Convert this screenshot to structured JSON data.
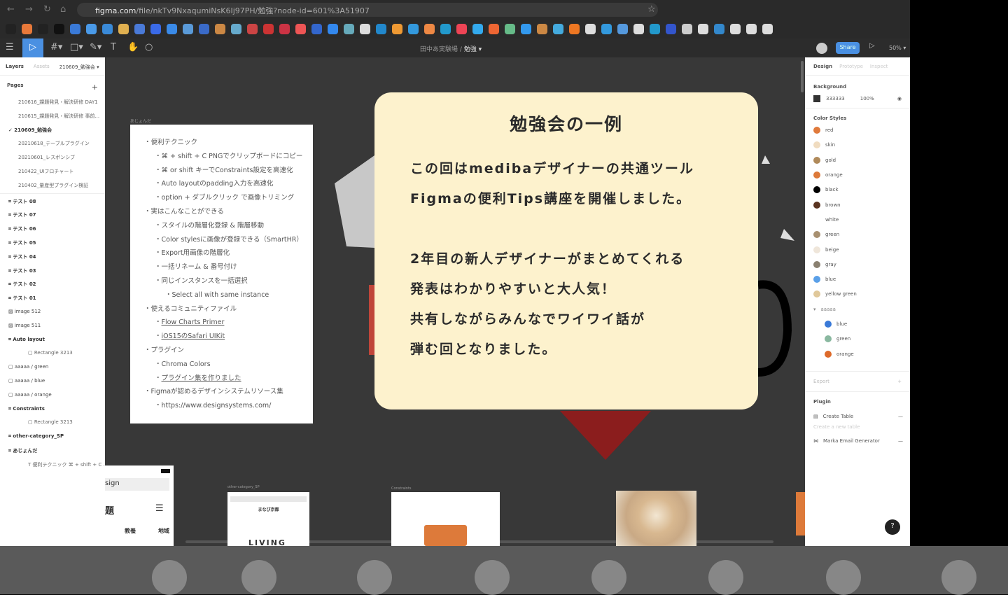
{
  "browser": {
    "url_domain": "figma.com",
    "url_path": "/file/nkTv9NxaqumiNsK6Ij97PH/勉強?node-id=601%3A51907"
  },
  "toolbar": {
    "breadcrumb_team": "田中あ実験場",
    "breadcrumb_sep": "/",
    "breadcrumb_file": "勉強 ▾",
    "share": "Share",
    "zoom": "50% ▾"
  },
  "left": {
    "tab_layers": "Layers",
    "tab_assets": "Assets",
    "page_select": "210609_勉強会 ▾",
    "pages_label": "Pages",
    "add": "+",
    "pages": [
      "210616_課題発見・解決研修 DAY1",
      "210615_課題発見・解決研修 事前...",
      "✓ 210609_勉強会",
      "20210618_テーブルプラグイン",
      "20210601_レスポンシブ",
      "210422_UIフロチャート",
      "210402_量産型プラグイン検証"
    ],
    "layers": [
      {
        "t": "⌗ テスト 08",
        "c": "bold"
      },
      {
        "t": "⌗ テスト 07",
        "c": "bold"
      },
      {
        "t": "⌗ テスト 06",
        "c": "bold"
      },
      {
        "t": "⌗ テスト 05",
        "c": "bold"
      },
      {
        "t": "⌗ テスト 04",
        "c": "bold"
      },
      {
        "t": "⌗ テスト 03",
        "c": "bold"
      },
      {
        "t": "⌗ テスト 02",
        "c": "bold"
      },
      {
        "t": "⌗ テスト 01",
        "c": "bold"
      },
      {
        "t": "▨ image 512",
        "c": ""
      },
      {
        "t": "▨ image 511",
        "c": ""
      },
      {
        "t": "⌗ Auto layout",
        "c": "bold"
      },
      {
        "t": "▢ Rectangle 3213",
        "c": "ind"
      },
      {
        "t": "▢ aaaaa / green",
        "c": ""
      },
      {
        "t": "▢ aaaaa / blue",
        "c": ""
      },
      {
        "t": "▢ aaaaa / orange",
        "c": ""
      },
      {
        "t": "⌗ Constraints",
        "c": "bold"
      },
      {
        "t": "▢ Rectangle 3213",
        "c": "ind"
      },
      {
        "t": "⌗ other-category_SP",
        "c": "bold"
      },
      {
        "t": "⌗ あじょんだ",
        "c": "bold"
      },
      {
        "t": "T 便利テクニック ⌘ + shift + C ...",
        "c": "ind"
      }
    ]
  },
  "canvas": {
    "note_label": "あじょんだ",
    "note": [
      {
        "t": "便利テクニック",
        "l": 1
      },
      {
        "t": "⌘ + shift + C PNGでクリップボードにコピー",
        "l": 2
      },
      {
        "t": "⌘ or shift キーでConstraints設定を高速化",
        "l": 2
      },
      {
        "t": "Auto layoutのpadding入力を高速化",
        "l": 2
      },
      {
        "t": "option + ダブルクリック で画像トリミング",
        "l": 2
      },
      {
        "t": "実はこんなことができる",
        "l": 1
      },
      {
        "t": "スタイルの階層化登録 & 階層移動",
        "l": 2
      },
      {
        "t": "Color stylesに画像が登録できる（SmartHR）",
        "l": 2
      },
      {
        "t": "Export用画像の階層化",
        "l": 2
      },
      {
        "t": "一括リネーム & 番号付け",
        "l": 2
      },
      {
        "t": "同じインスタンスを一括選択",
        "l": 2
      },
      {
        "t": "Select all with same instance",
        "l": 3
      },
      {
        "t": "使えるコミュニティファイル",
        "l": 1
      },
      {
        "t": "Flow Charts Primer",
        "l": 2,
        "link": true
      },
      {
        "t": "iOS15のSafari UIKit",
        "l": 2,
        "link": true
      },
      {
        "t": "プラグイン",
        "l": 1
      },
      {
        "t": "Chroma Colors",
        "l": 2
      },
      {
        "t": "プラグイン集を作りました",
        "l": 2,
        "link": true
      },
      {
        "t": "Figmaが認めるデザインシステムリソース集",
        "l": 1
      },
      {
        "t": "https://www.designsystems.com/",
        "l": 2
      }
    ],
    "card_title": "勉強会の一例",
    "card_lines": [
      "この回はmedibaデザイナーの共通ツール",
      "Figmaの便利Tips講座を開催しました。",
      "",
      "2年目の新人デザイナーがまとめてくれる",
      "発表はわかりやすいと大人気！",
      "共有しながらみんなでワイワイ話が",
      "弾む回となりました。"
    ],
    "frame_other": "other-category_SP",
    "frame_constraints": "Constraints",
    "phone_title": "まなび京都",
    "living": "LIVING",
    "sp_tabs": [
      "教養",
      "地域"
    ],
    "sp_design": "sign",
    "sp_heading": "題"
  },
  "right": {
    "tab_design": "Design",
    "tab_prototype": "Prototype",
    "tab_inspect": "Inspect",
    "bg_label": "Background",
    "bg_hex": "333333",
    "bg_opacity": "100%",
    "color_styles": "Color Styles",
    "colors": [
      {
        "n": "red",
        "c": "#e07a3c"
      },
      {
        "n": "skin",
        "c": "#f0dcc0"
      },
      {
        "n": "gold",
        "c": "#b08a5a"
      },
      {
        "n": "orange",
        "c": "#dd7a3a"
      },
      {
        "n": "black",
        "c": "#000000"
      },
      {
        "n": "brown",
        "c": "#5a3420"
      },
      {
        "n": "white",
        "c": "#ffffff"
      },
      {
        "n": "green",
        "c": "#a89070"
      },
      {
        "n": "beige",
        "c": "#efe6da"
      },
      {
        "n": "gray",
        "c": "#8a8070"
      },
      {
        "n": "blue",
        "c": "#5aa0e8"
      },
      {
        "n": "yellow green",
        "c": "#e0c89a"
      }
    ],
    "group": "aaaaa",
    "group_colors": [
      {
        "n": "blue",
        "c": "#3a7ad8"
      },
      {
        "n": "green",
        "c": "#8ab8a0"
      },
      {
        "n": "orange",
        "c": "#dd6a2a"
      }
    ],
    "export": "Export",
    "plugin": "Plugin",
    "plugins": [
      "Create Table",
      "Marka Email Generator"
    ],
    "plugin_sub": "Create a new table",
    "help": "?"
  }
}
